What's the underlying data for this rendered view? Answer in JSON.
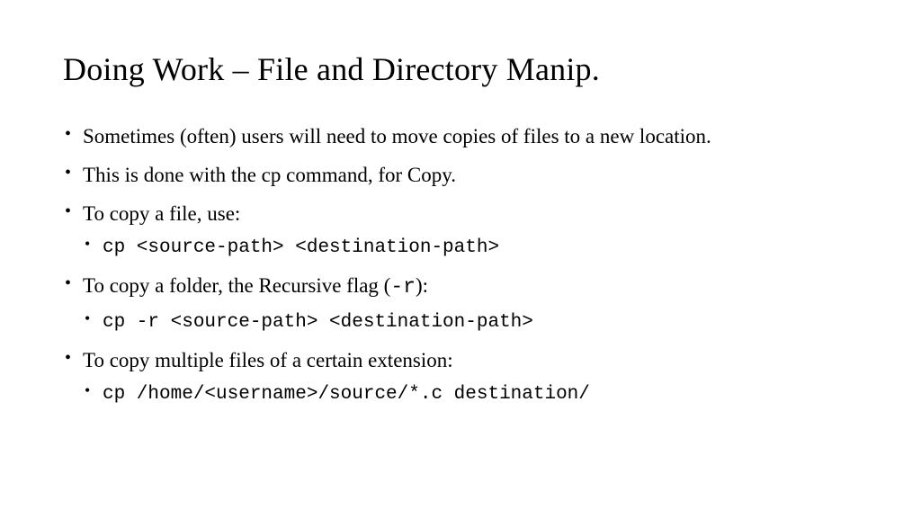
{
  "title": "Doing Work – File and Directory Manip.",
  "bullets": {
    "b1": "Sometimes (often) users will need to move copies of files to a new location.",
    "b2": "This is done with the cp command, for Copy.",
    "b3": "To copy a file, use:",
    "b3_code": "cp <source-path> <destination-path>",
    "b4_pre": "To copy a folder, the Recursive flag (",
    "b4_flag": "-r",
    "b4_post": "):",
    "b4_code": "cp -r <source-path> <destination-path>",
    "b5": "To copy multiple files of a certain extension:",
    "b5_code": "cp /home/<username>/source/*.c destination/"
  }
}
